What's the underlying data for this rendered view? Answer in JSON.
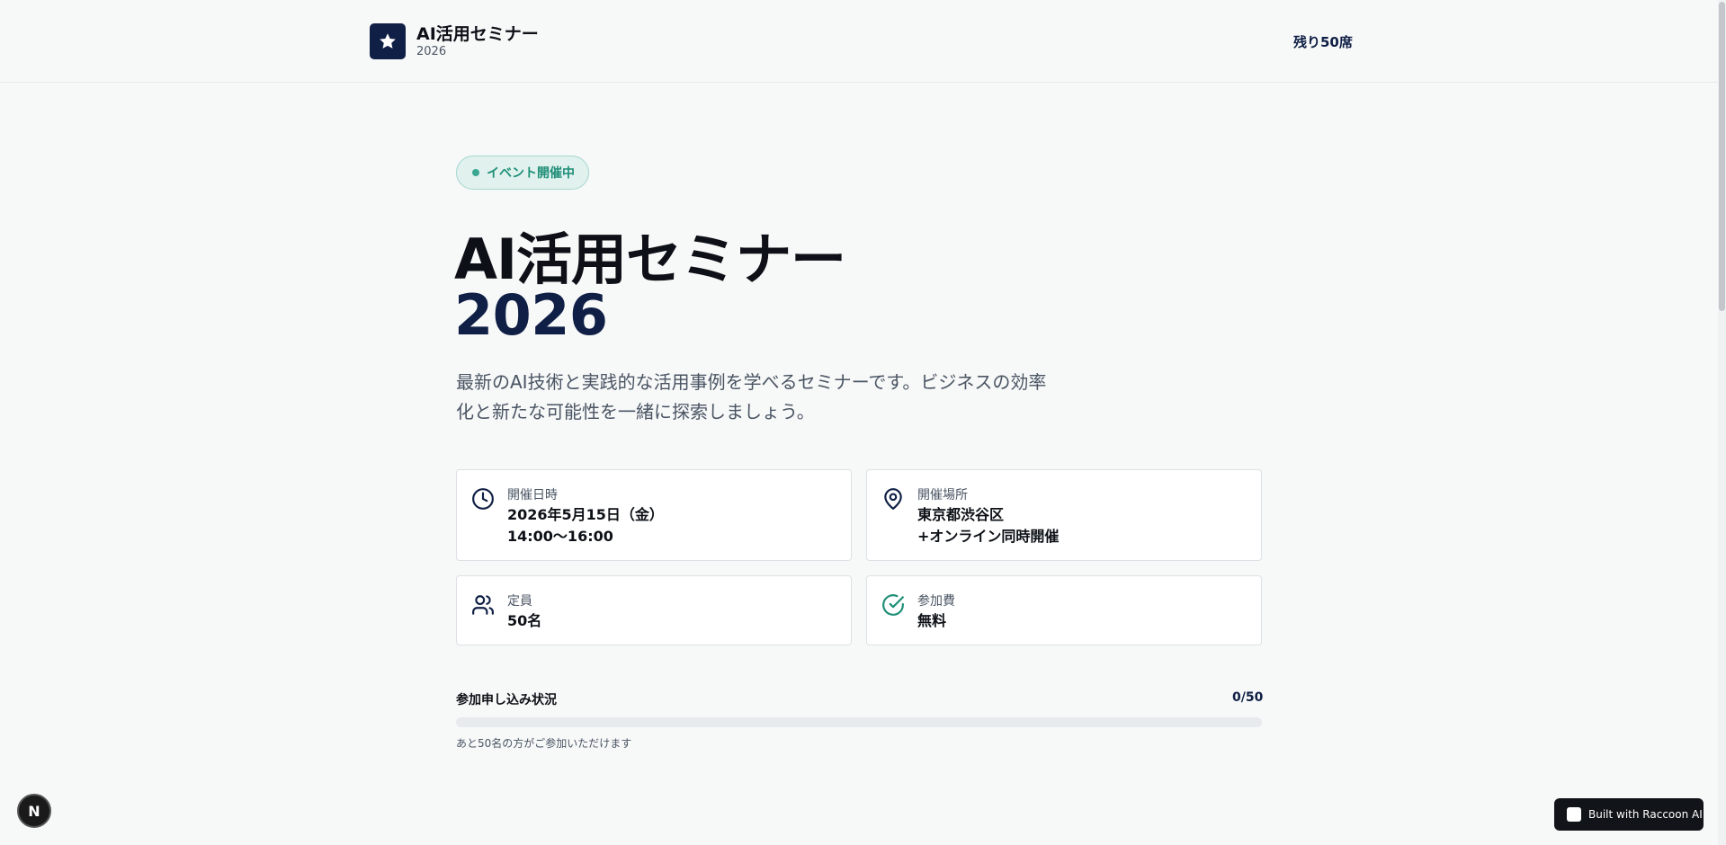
{
  "header": {
    "brand_title": "AI活用セミナー",
    "brand_sub": "2026",
    "seats_left": "残り50席"
  },
  "hero": {
    "status_badge": "イベント開催中",
    "title_line1": "AI活用セミナー",
    "title_line2": "2026",
    "description": "最新のAI技術と実践的な活用事例を学べるセミナーです。ビジネスの効率化と新たな可能性を一緒に探索しましょう。"
  },
  "cards": {
    "datetime": {
      "label": "開催日時",
      "value_line1": "2026年5月15日（金）",
      "value_line2": "14:00〜16:00",
      "icon": "clock-icon"
    },
    "location": {
      "label": "開催場所",
      "value_line1": "東京都渋谷区",
      "value_line2": "+オンライン同時開催",
      "icon": "map-pin-icon"
    },
    "capacity": {
      "label": "定員",
      "value": "50名",
      "icon": "users-icon"
    },
    "fee": {
      "label": "参加費",
      "value": "無料",
      "icon": "check-circle-icon"
    }
  },
  "registration": {
    "label": "参加申し込み状況",
    "count": "0/50",
    "filled_fraction": 0,
    "note": "あと50名の方がご参加いただけます"
  },
  "footer": {
    "dev_button": "N",
    "built_with": "Built with Raccoon AI"
  },
  "colors": {
    "accent": "#0f1f45",
    "badge_green": "#1f8f78",
    "background": "#f7f8f8"
  }
}
